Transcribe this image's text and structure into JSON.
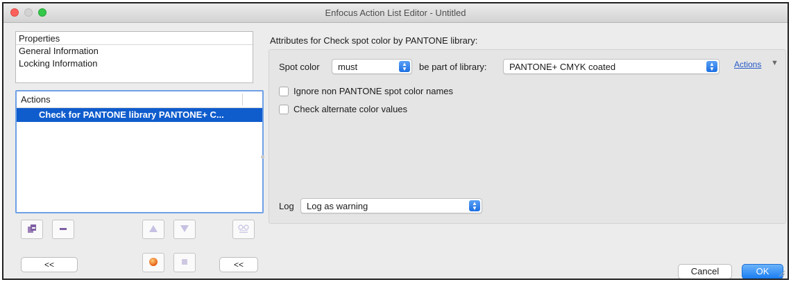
{
  "window": {
    "title": "Enfocus Action List Editor - Untitled"
  },
  "properties": {
    "header": "Properties",
    "items": [
      "General Information",
      "Locking Information"
    ]
  },
  "actions_list": {
    "header": "Actions",
    "items": [
      "Check for PANTONE library PANTONE+ C..."
    ]
  },
  "buttons": {
    "collapse_left": "<<",
    "collapse_mid": "<<",
    "cancel": "Cancel",
    "ok": "OK"
  },
  "attributes": {
    "heading": "Attributes for Check spot color by PANTONE library:",
    "spot_color_label": "Spot color",
    "spot_color_mode": "must",
    "library_label": "be part of library:",
    "library": "PANTONE+ CMYK coated",
    "actions_menu": "Actions",
    "checkboxes": [
      {
        "label": "Ignore non PANTONE spot color names",
        "checked": false
      },
      {
        "label": "Check alternate color values",
        "checked": false
      }
    ],
    "log_label": "Log",
    "log_value": "Log as warning"
  },
  "colors": {
    "selection": "#0f5ccd",
    "accent": "#1a7df2",
    "link": "#2459c8"
  }
}
